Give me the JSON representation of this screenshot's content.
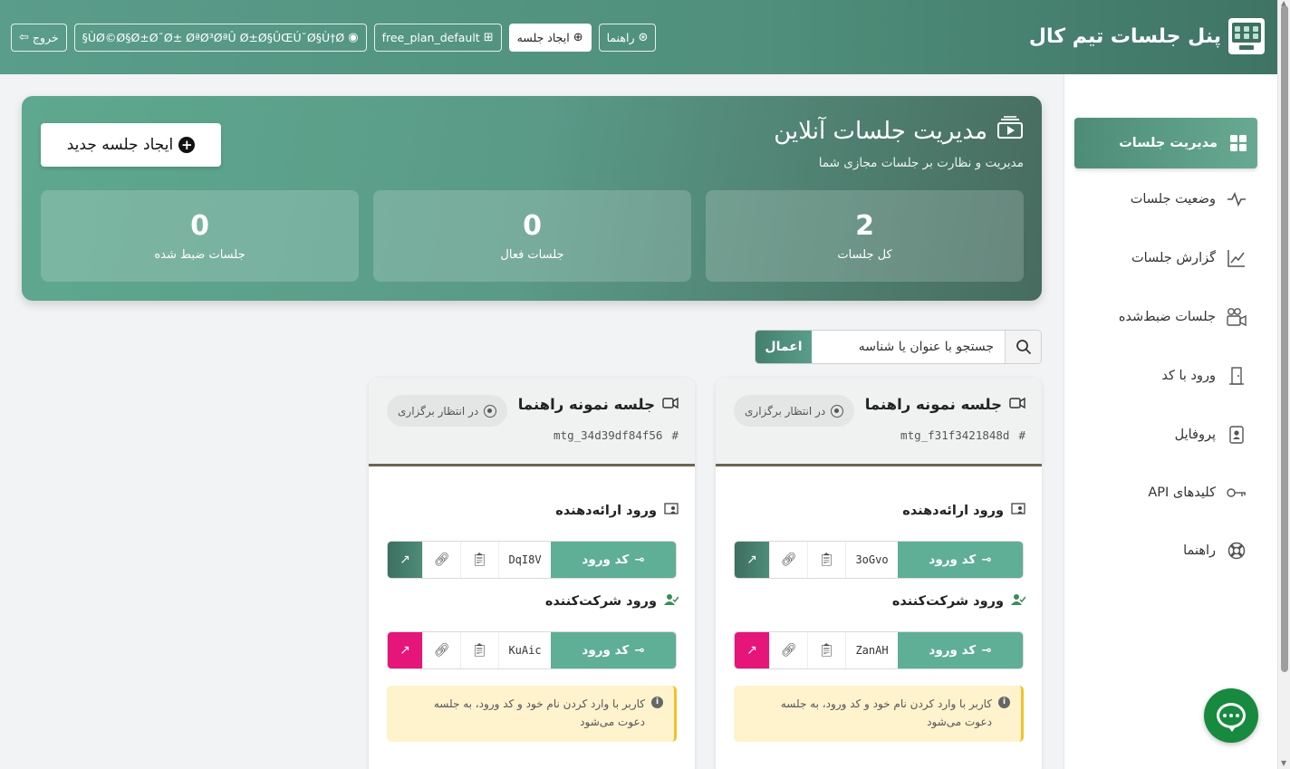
{
  "header": {
    "title": "پنل جلسات تیم کال",
    "buttons": {
      "logout": "خروج",
      "user": "§ÙØ©Ø§Ø±Ø¯Ø± ØªØ³ØªÛ Ø±Ø§ÛŒÚ¯Ø§Ù†Ø",
      "plan": "free_plan_default",
      "create": "ایجاد جلسه",
      "help": "راهنما"
    }
  },
  "sidebar": {
    "items": [
      {
        "label": "مدیریت جلسات",
        "icon": "grid-icon"
      },
      {
        "label": "وضعیت جلسات",
        "icon": "pulse-icon"
      },
      {
        "label": "گزارش جلسات",
        "icon": "chart-line-icon"
      },
      {
        "label": "جلسات ضبط‌شده",
        "icon": "camera-reels-icon"
      },
      {
        "label": "ورود با کد",
        "icon": "door-icon"
      },
      {
        "label": "پروفایل",
        "icon": "person-badge-icon"
      },
      {
        "label": "کلیدهای API",
        "icon": "key-icon"
      },
      {
        "label": "راهنما",
        "icon": "lifebuoy-icon"
      }
    ]
  },
  "hero": {
    "title": "مدیریت جلسات آنلاین",
    "subtitle": "مدیریت و نظارت بر جلسات مجازی شما",
    "new_button": "ایجاد جلسه جدید",
    "stats": [
      {
        "value": "2",
        "label": "کل جلسات"
      },
      {
        "value": "0",
        "label": "جلسات فعال"
      },
      {
        "value": "0",
        "label": "جلسات ضبط شده"
      }
    ]
  },
  "search": {
    "placeholder": "جستجو با عنوان یا شناسه",
    "apply": "اعمال"
  },
  "meetings": [
    {
      "title": "جلسه نمونه راهنما",
      "id": "mtg_f31f3421848d",
      "status": "در انتظار برگزاری",
      "presenter_label": "ورود ارائه‌دهنده",
      "attendee_label": "ورود شرکت‌کننده",
      "code_label": "کد ورود",
      "presenter_code": "3oGvo",
      "attendee_code": "ZanAH",
      "note": "کاربر با وارد کردن نام خود و کد ورود، به جلسه دعوت می‌شود"
    },
    {
      "title": "جلسه نمونه راهنما",
      "id": "mtg_34d39df84f56",
      "status": "در انتظار برگزاری",
      "presenter_label": "ورود ارائه‌دهنده",
      "attendee_label": "ورود شرکت‌کننده",
      "code_label": "کد ورود",
      "presenter_code": "DqI8V",
      "attendee_code": "KuAic",
      "note": "کاربر با وارد کردن نام خود و کد ورود، به جلسه دعوت می‌شود"
    }
  ],
  "colors": {
    "brand": "#5a9d8a",
    "brand_dark": "#3f7464",
    "accent_pink": "#e5157a",
    "note_bg": "#fff3cd",
    "note_border": "#f0c22a",
    "chat": "#178a3f"
  }
}
